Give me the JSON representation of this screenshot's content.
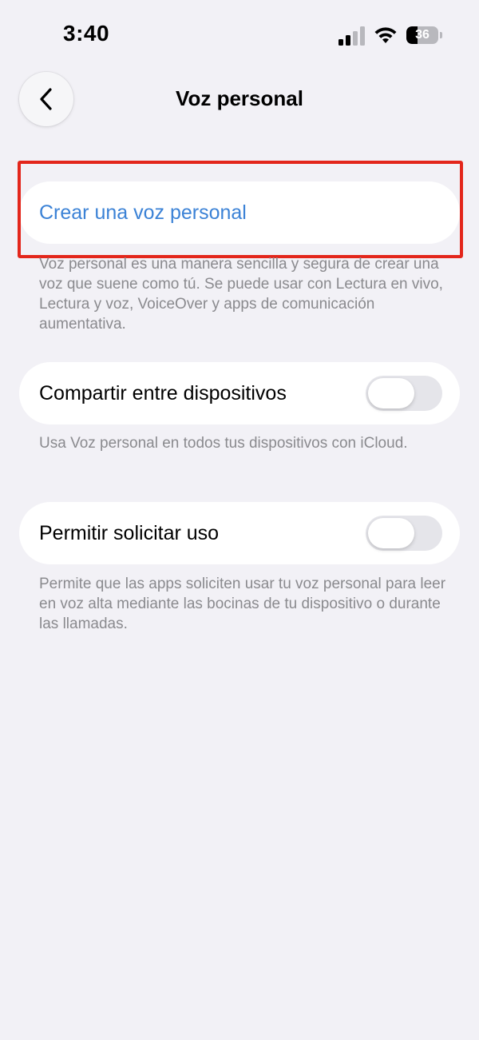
{
  "status_bar": {
    "time": "3:40",
    "battery_level": "36",
    "battery_fraction": 0.36,
    "signal_bars_active": 2,
    "icons": [
      "cellular-signal-icon",
      "wifi-icon",
      "battery-icon"
    ]
  },
  "nav": {
    "title": "Voz personal",
    "back_icon": "chevron-left-icon"
  },
  "create_section": {
    "label": "Crear una voz personal",
    "footer": "Voz personal es una manera sencilla y segura de crear una voz que suene como tú. Se puede usar con Lectura en vivo, Lectura y voz, VoiceOver y apps de comunicación aumentativa."
  },
  "share_section": {
    "label": "Compartir entre dispositivos",
    "toggle_on": false,
    "footer": "Usa Voz personal en todos tus dispositivos con iCloud."
  },
  "request_section": {
    "label": "Permitir solicitar uso",
    "toggle_on": false,
    "footer": "Permite que las apps soliciten usar tu voz personal para leer en voz alta mediante las bocinas de tu dispositivo o durante las llamadas."
  },
  "colors": {
    "background": "#f2f1f6",
    "accent_link": "#3b82d6",
    "highlight": "#e3261b",
    "footnote": "#8a8a8e",
    "toggle_off": "#e5e5ea"
  }
}
